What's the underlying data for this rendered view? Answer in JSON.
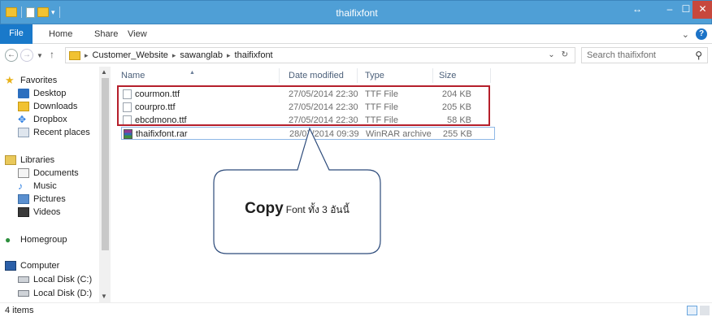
{
  "window": {
    "title": "thaifixfont"
  },
  "ribbon": {
    "tabs": [
      "File",
      "Home",
      "Share",
      "View"
    ]
  },
  "address": {
    "crumbs": [
      "Customer_Website",
      "sawanglab",
      "thaifixfont"
    ],
    "search_placeholder": "Search thaifixfont"
  },
  "nav": {
    "favorites": {
      "label": "Favorites",
      "items": [
        "Desktop",
        "Downloads",
        "Dropbox",
        "Recent places"
      ]
    },
    "libraries": {
      "label": "Libraries",
      "items": [
        "Documents",
        "Music",
        "Pictures",
        "Videos"
      ]
    },
    "homegroup": "Homegroup",
    "computer": {
      "label": "Computer",
      "items": [
        "Local Disk (C:)",
        "Local Disk (D:)"
      ]
    }
  },
  "list": {
    "columns": {
      "name": "Name",
      "date": "Date modified",
      "type": "Type",
      "size": "Size"
    },
    "files": [
      {
        "name": "courmon.ttf",
        "date": "27/05/2014 22:30",
        "type": "TTF File",
        "size": "204 KB",
        "icon": "ttf-file-icon"
      },
      {
        "name": "courpro.ttf",
        "date": "27/05/2014 22:30",
        "type": "TTF File",
        "size": "205 KB",
        "icon": "ttf-file-icon"
      },
      {
        "name": "ebcdmono.ttf",
        "date": "27/05/2014 22:30",
        "type": "TTF File",
        "size": "58 KB",
        "icon": "ttf-file-icon"
      },
      {
        "name": "thaifixfont.rar",
        "date": "28/07/2014 09:39",
        "type": "WinRAR archive",
        "size": "255 KB",
        "icon": "rar-archive-icon"
      }
    ]
  },
  "callout": {
    "emphasis": "Copy",
    "text": "Font ทั้ง 3 อันนี้"
  },
  "status": {
    "items": "4 items"
  },
  "colors": {
    "titlebar": "#4f9fd6",
    "file_tab": "#1979ca",
    "highlight": "#b51f2b",
    "close": "#c7483d"
  }
}
